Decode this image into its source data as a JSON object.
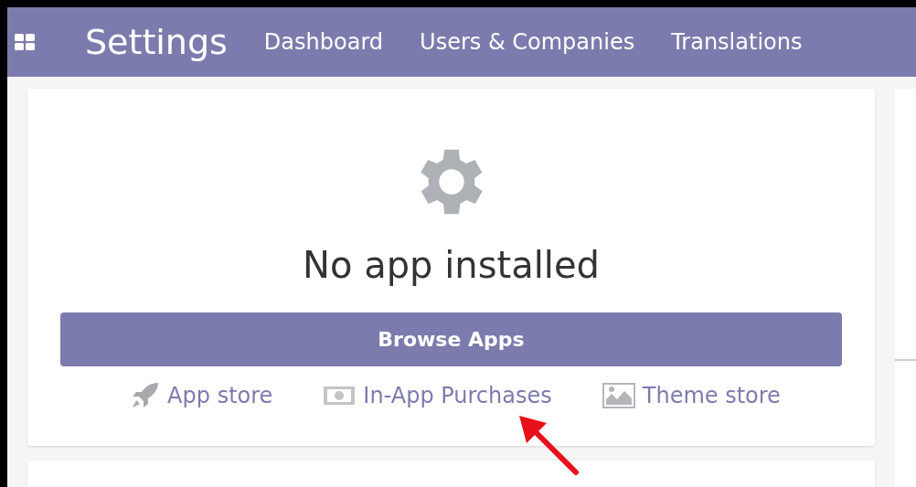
{
  "navbar": {
    "title": "Settings",
    "menu": [
      "Dashboard",
      "Users & Companies",
      "Translations"
    ]
  },
  "empty_state": {
    "message": "No app installed",
    "button": "Browse Apps",
    "links": [
      {
        "kind": "rocket",
        "label": "App store"
      },
      {
        "kind": "money",
        "label": "In-App Purchases"
      },
      {
        "kind": "image",
        "label": "Theme store"
      }
    ]
  },
  "annotation": {
    "kind": "arrow"
  }
}
